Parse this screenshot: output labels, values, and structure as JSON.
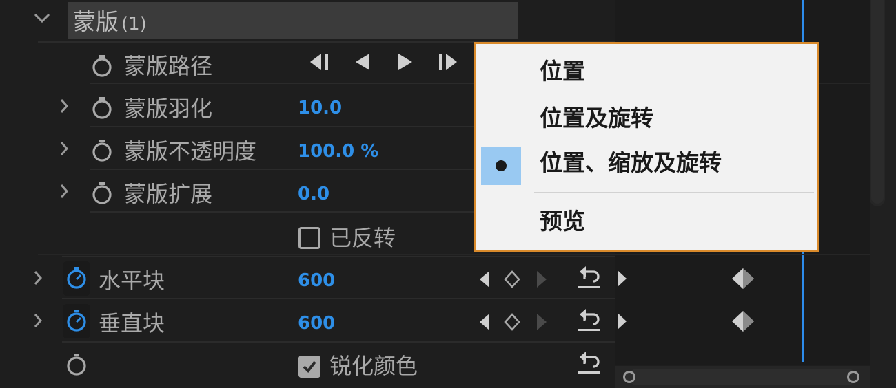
{
  "section": {
    "title": "蒙版",
    "count": "(1)"
  },
  "mask_properties": [
    {
      "label": "蒙版路径"
    },
    {
      "label": "蒙版羽化",
      "value": "10.0"
    },
    {
      "label": "蒙版不透明度",
      "value": "100.0 %"
    },
    {
      "label": "蒙版扩展",
      "value": "0.0"
    }
  ],
  "inverted": {
    "label": "已反转",
    "checked": false
  },
  "params": [
    {
      "label": "水平块",
      "value": "600"
    },
    {
      "label": "垂直块",
      "value": "600"
    }
  ],
  "sharpen": {
    "label": "锐化颜色",
    "checked": true
  },
  "menu": {
    "items": [
      "位置",
      "位置及旋转",
      "位置、缩放及旋转",
      "预览"
    ],
    "selected_index": 2
  },
  "colors": {
    "accent_blue": "#2e8fe8",
    "menu_border": "#d98a2b",
    "menu_selection": "#99c9f2",
    "playhead": "#2d8ceb"
  },
  "icons": {
    "stopwatch": "stopwatch-icon",
    "reset": "reset-icon",
    "keyframe": "keyframe-diamond-icon",
    "prev_keyframe": "previous-keyframe-icon",
    "next_keyframe": "next-keyframe-icon"
  }
}
